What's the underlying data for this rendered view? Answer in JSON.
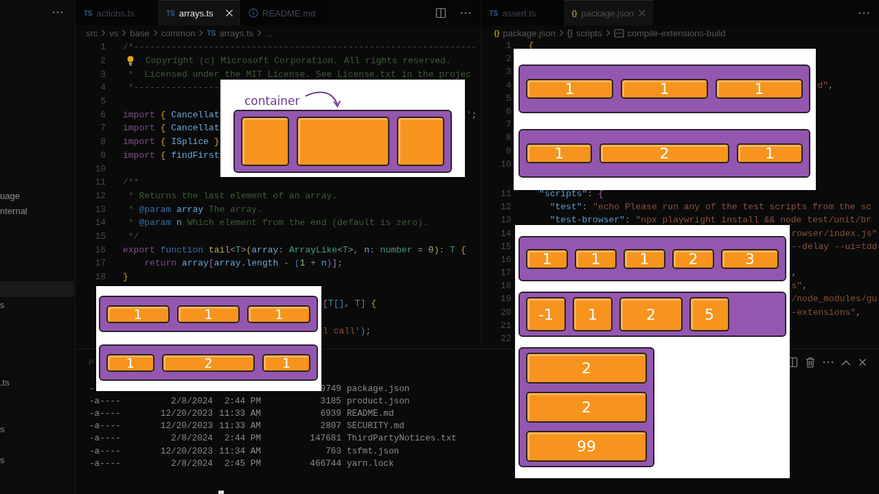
{
  "sidebar": {
    "items": [
      {
        "label": "uage",
        "selected": false
      },
      {
        "label": "nternal",
        "selected": false
      },
      {
        "selected": true
      },
      {
        "label": "s",
        "selected": false
      },
      {
        "label": ".ts",
        "selected": false
      },
      {
        "label": "s",
        "selected": false
      },
      {
        "label": "s",
        "selected": false
      }
    ]
  },
  "editor_groups": [
    {
      "focused": true,
      "tabs": [
        {
          "kind": "ts",
          "badge": "TS",
          "label": "actions.ts",
          "selected": false
        },
        {
          "kind": "ts",
          "badge": "TS",
          "label": "arrays.ts",
          "selected": true
        },
        {
          "kind": "info",
          "label": "README.md",
          "selected": false
        }
      ],
      "breadcrumb": [
        {
          "kind": "folder",
          "label": "src"
        },
        {
          "kind": "folder",
          "label": "vs"
        },
        {
          "kind": "folder",
          "label": "base"
        },
        {
          "kind": "folder",
          "label": "common"
        },
        {
          "kind": "ts",
          "badge": "TS",
          "label": "arrays.ts"
        },
        {
          "kind": "folder",
          "label": "..."
        }
      ],
      "lines": [
        {
          "number": "1",
          "parts": [
            {
              "text": "/*----------------------------------------------------------------",
              "kind": "comment"
            }
          ]
        },
        {
          "number": "2",
          "lightbulb": true,
          "parts": [
            {
              "text": "Copyright (c) Microsoft Corporation. All rights reserved.",
              "kind": "comment"
            }
          ]
        },
        {
          "number": "3",
          "parts": [
            {
              "text": " *  Licensed under the MIT License. See License.txt in the projec",
              "kind": "comment"
            }
          ]
        },
        {
          "number": "4",
          "parts": [
            {
              "text": " *----------------",
              "kind": "comment"
            }
          ]
        },
        {
          "number": "5"
        },
        {
          "number": "6",
          "parts": [
            {
              "text": "import ",
              "kind": "keyword"
            },
            {
              "text": "{",
              "kind": "bracket"
            },
            {
              "text": " Cancellat",
              "kind": "variable"
            }
          ],
          "rest": [
            {
              "text": "'",
              "kind": "string"
            },
            {
              "text": ";",
              "kind": "plain"
            }
          ]
        },
        {
          "number": "7",
          "parts": [
            {
              "text": "import ",
              "kind": "keyword"
            },
            {
              "text": "{",
              "kind": "bracket"
            },
            {
              "text": " Cancellat",
              "kind": "variable"
            }
          ]
        },
        {
          "number": "8",
          "parts": [
            {
              "text": "import ",
              "kind": "keyword"
            },
            {
              "text": "{",
              "kind": "bracket"
            },
            {
              "text": " ISplice ",
              "kind": "variable"
            },
            {
              "text": "}",
              "kind": "bracket"
            }
          ]
        },
        {
          "number": "9",
          "parts": [
            {
              "text": "import ",
              "kind": "keyword"
            },
            {
              "text": "{",
              "kind": "bracket"
            },
            {
              "text": " findFirst",
              "kind": "variable"
            }
          ]
        },
        {
          "number": "10"
        },
        {
          "number": "11",
          "parts": [
            {
              "text": "/**",
              "kind": "comment"
            }
          ]
        },
        {
          "number": "12",
          "parts": [
            {
              "text": " * Returns the last element of an array.",
              "kind": "comment"
            }
          ]
        },
        {
          "number": "13",
          "parts": [
            {
              "text": " * ",
              "kind": "comment"
            },
            {
              "text": "@param ",
              "kind": "storage"
            },
            {
              "text": "array",
              "kind": "variable"
            },
            {
              "text": " The array.",
              "kind": "comment"
            }
          ]
        },
        {
          "number": "14",
          "parts": [
            {
              "text": " * ",
              "kind": "comment"
            },
            {
              "text": "@param ",
              "kind": "storage"
            },
            {
              "text": "n",
              "kind": "variable"
            },
            {
              "text": " Which element from the end (default is zero).",
              "kind": "comment"
            }
          ]
        },
        {
          "number": "15",
          "parts": [
            {
              "text": " */",
              "kind": "comment"
            }
          ]
        },
        {
          "number": "16",
          "parts": [
            {
              "text": "export ",
              "kind": "keyword"
            },
            {
              "text": "function ",
              "kind": "storage"
            },
            {
              "text": "tail",
              "kind": "function"
            },
            {
              "text": "<",
              "kind": "plain"
            },
            {
              "text": "T",
              "kind": "type"
            },
            {
              "text": ">",
              "kind": "plain"
            },
            {
              "text": "(",
              "kind": "bracket"
            },
            {
              "text": "array",
              "kind": "variable"
            },
            {
              "text": ": ",
              "kind": "plain"
            },
            {
              "text": "ArrayLike",
              "kind": "type"
            },
            {
              "text": "<",
              "kind": "plain"
            },
            {
              "text": "T",
              "kind": "type"
            },
            {
              "text": ">, ",
              "kind": "plain"
            },
            {
              "text": "n",
              "kind": "variable"
            },
            {
              "text": ": ",
              "kind": "plain"
            },
            {
              "text": "number",
              "kind": "type"
            },
            {
              "text": " = ",
              "kind": "plain"
            },
            {
              "text": "0",
              "kind": "number"
            },
            {
              "text": ")",
              "kind": "bracket"
            },
            {
              "text": ": ",
              "kind": "plain"
            },
            {
              "text": "T ",
              "kind": "type"
            },
            {
              "text": "{",
              "kind": "bracket"
            }
          ]
        },
        {
          "number": "17",
          "parts": [
            {
              "text": "    return ",
              "kind": "keyword"
            },
            {
              "text": "array",
              "kind": "variable"
            },
            {
              "text": "[",
              "kind": "bracket2"
            },
            {
              "text": "array",
              "kind": "variable"
            },
            {
              "text": ".",
              "kind": "plain"
            },
            {
              "text": "length",
              "kind": "variable"
            },
            {
              "text": " - ",
              "kind": "plain"
            },
            {
              "text": "(",
              "kind": "bracket3"
            },
            {
              "text": "1",
              "kind": "number"
            },
            {
              "text": " + ",
              "kind": "plain"
            },
            {
              "text": "n",
              "kind": "variable"
            },
            {
              "text": ")",
              "kind": "bracket3"
            },
            {
              "text": "]",
              "kind": "bracket2"
            },
            {
              "text": ";",
              "kind": "plain"
            }
          ]
        },
        {
          "number": "18",
          "parts": [
            {
              "text": "}",
              "kind": "bracket"
            }
          ]
        },
        {
          "rest": [
            {
              "text": "[",
              "kind": "bracket2"
            },
            {
              "text": "T",
              "kind": "type"
            },
            {
              "text": "[]",
              "kind": "bracket3"
            },
            {
              "text": ", ",
              "kind": "plain"
            },
            {
              "text": "T",
              "kind": "type"
            },
            {
              "text": "] ",
              "kind": "bracket2"
            },
            {
              "text": "{",
              "kind": "bracket"
            }
          ]
        },
        {
          "rest": [
            {
              "text": "l call'",
              "kind": "string"
            },
            {
              "text": ")",
              "kind": "bracket3"
            },
            {
              "text": ";",
              "kind": "plain"
            }
          ]
        }
      ]
    },
    {
      "focused": false,
      "tabs": [
        {
          "kind": "ts",
          "badge": "TS",
          "label": "assert.ts",
          "selected": false
        },
        {
          "kind": "json",
          "badge": "{}",
          "label": "package.json",
          "selected": true
        }
      ],
      "breadcrumb": [
        {
          "kind": "json",
          "badge": "{}",
          "label": "package.json"
        },
        {
          "kind": "object",
          "badge": "{}",
          "label": "scripts"
        },
        {
          "kind": "field",
          "label": "compile-extensions-build"
        }
      ],
      "lines": [
        {
          "number": "1",
          "parts": [
            {
              "text": "{",
              "kind": "bracket"
            }
          ]
        },
        {
          "number": "2"
        },
        {
          "number": "3"
        },
        {
          "number": "4",
          "rest": [
            {
              "text": "d\"",
              "kind": "string"
            },
            {
              "text": ",",
              "kind": "plain"
            }
          ]
        },
        {
          "number": "5"
        },
        {
          "number": "6"
        },
        {
          "number": "7"
        },
        {
          "number": "8"
        },
        {
          "number": "9"
        },
        {
          "number": "10"
        },
        {
          "number": "11",
          "parts": [
            {
              "text": "  \"scripts\"",
              "kind": "key"
            },
            {
              "text": ": ",
              "kind": "plain"
            },
            {
              "text": "{",
              "kind": "bracket2"
            }
          ]
        },
        {
          "number": "12",
          "parts": [
            {
              "text": "    \"test\"",
              "kind": "key"
            },
            {
              "text": ": ",
              "kind": "plain"
            },
            {
              "text": "\"echo Please run any of the test scripts from the sc",
              "kind": "string"
            }
          ]
        },
        {
          "number": "13",
          "parts": [
            {
              "text": "    \"test-browser\"",
              "kind": "key"
            },
            {
              "text": ": ",
              "kind": "plain"
            },
            {
              "text": "\"npx playwright install && node test/unit/br",
              "kind": "string"
            }
          ]
        },
        {
          "number": "14",
          "rest": [
            {
              "text": "rowser/index.js\"",
              "kind": "string"
            }
          ]
        },
        {
          "number": "15",
          "rest": [
            {
              "text": "--delay --ui=tdd",
              "kind": "string"
            }
          ]
        },
        {
          "number": "16"
        },
        {
          "number": "17",
          "rest": [
            {
              "text": ",",
              "kind": "plain"
            }
          ]
        },
        {
          "number": "18",
          "rest": [
            {
              "text": "s\"",
              "kind": "string"
            },
            {
              "text": ",",
              "kind": "plain"
            }
          ]
        },
        {
          "number": "19",
          "rest": [
            {
              "text": "/node_modules/gu",
              "kind": "string"
            }
          ]
        },
        {
          "number": "20",
          "rest": [
            {
              "text": "-extensions\"",
              "kind": "string"
            },
            {
              "text": ",",
              "kind": "plain"
            }
          ]
        },
        {
          "number": "21"
        },
        {
          "number": "22"
        }
      ]
    }
  ],
  "panel": {
    "tab": "P",
    "rows": [
      {
        "mode": "-",
        "size": "9749",
        "name": "package.json"
      },
      {
        "mode": "-a----",
        "date": "2/8/2024",
        "time": "2:44 PM",
        "size": "3185",
        "name": "product.json"
      },
      {
        "mode": "-a----",
        "date": "12/20/2023",
        "time": "11:33 AM",
        "size": "6939",
        "name": "README.md"
      },
      {
        "mode": "-a----",
        "date": "12/20/2023",
        "time": "11:33 AM",
        "size": "2807",
        "name": "SECURITY.md"
      },
      {
        "mode": "-a----",
        "date": "2/8/2024",
        "time": "2:44 PM",
        "size": "147681",
        "name": "ThirdPartyNotices.txt"
      },
      {
        "mode": "-a----",
        "date": "12/20/2023",
        "time": "11:34 AM",
        "size": "763",
        "name": "tsfmt.json"
      },
      {
        "mode": "-a----",
        "date": "2/8/2024",
        "time": "2:45 PM",
        "size": "466744",
        "name": "yarn.lock"
      }
    ]
  },
  "diagrams": [
    {
      "label": "container",
      "containers": [
        {
          "kind": "row",
          "items": [
            {
              "kind": "normal"
            },
            {
              "kind": "wide"
            },
            {
              "kind": "normal"
            }
          ]
        }
      ]
    },
    {
      "containers": [
        {
          "kind": "row",
          "items": [
            {
              "kind": "normal",
              "label": "1"
            },
            {
              "kind": "normal",
              "label": "1"
            },
            {
              "kind": "normal",
              "label": "1"
            }
          ]
        },
        {
          "kind": "row",
          "items": [
            {
              "kind": "normal",
              "label": "1"
            },
            {
              "kind": "wide",
              "label": "2"
            },
            {
              "kind": "normal",
              "label": "1"
            }
          ]
        }
      ]
    },
    {
      "containers": [
        {
          "kind": "row",
          "items": [
            {
              "kind": "normal",
              "label": "1"
            },
            {
              "kind": "normal",
              "label": "1"
            },
            {
              "kind": "normal",
              "label": "1"
            }
          ]
        },
        {
          "kind": "row",
          "items": [
            {
              "kind": "normal",
              "label": "1"
            },
            {
              "kind": "wide",
              "label": "2"
            },
            {
              "kind": "normal",
              "label": "1"
            }
          ]
        }
      ]
    },
    {
      "containers": [
        {
          "kind": "row",
          "items": [
            {
              "kind": "normal",
              "label": "1"
            },
            {
              "kind": "normal",
              "label": "1"
            },
            {
              "kind": "normal",
              "label": "1"
            },
            {
              "kind": "normal",
              "label": "2"
            },
            {
              "kind": "large",
              "label": "3"
            }
          ]
        },
        {
          "kind": "packed",
          "items": [
            {
              "kind": "normal",
              "label": "-1"
            },
            {
              "kind": "normal",
              "label": "1"
            },
            {
              "kind": "wide",
              "label": "2"
            },
            {
              "kind": "normal",
              "label": "5"
            }
          ]
        },
        {
          "kind": "column",
          "items": [
            {
              "kind": "normal",
              "label": "2"
            },
            {
              "kind": "normal",
              "label": "2"
            },
            {
              "kind": "normal",
              "label": "99"
            }
          ]
        }
      ]
    }
  ]
}
